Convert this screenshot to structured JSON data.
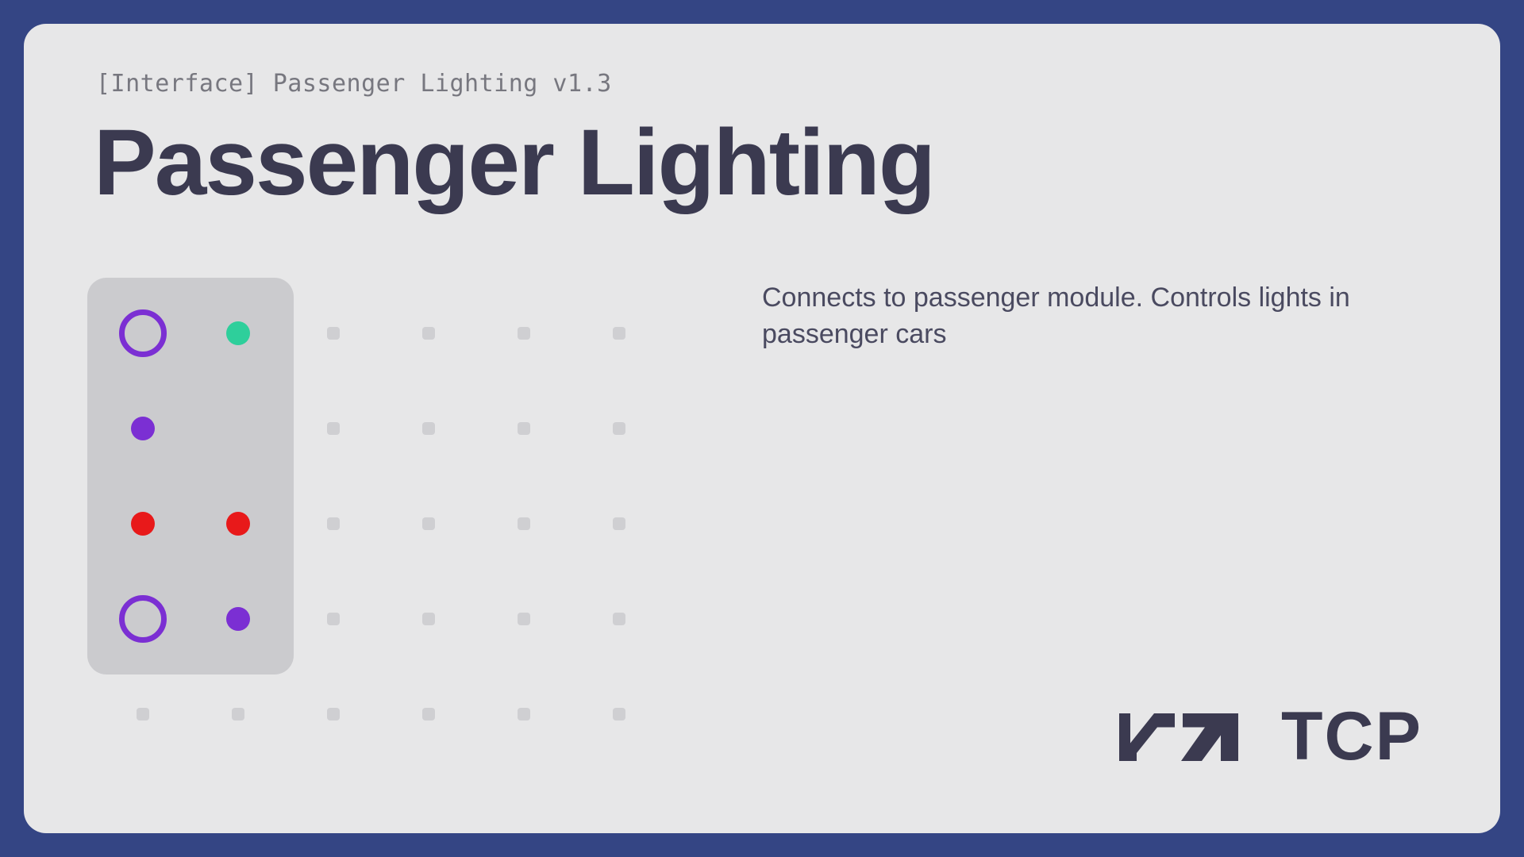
{
  "header": {
    "subtitle": "[Interface] Passenger Lighting v1.3",
    "title": "Passenger Lighting"
  },
  "description": "Connects to passenger module. Controls lights in passenger cars",
  "colors": {
    "background": "#344584",
    "card": "#e7e7e8",
    "panel": "#cbcbce",
    "text_dark": "#3b3a50",
    "purple": "#7b2fd3",
    "green": "#2ecf9b",
    "red": "#e8191a",
    "empty_pin": "#cfcfd2"
  },
  "connector": {
    "columns": 6,
    "rows": 5,
    "pins": [
      {
        "row": 0,
        "col": 0,
        "type": "ring",
        "color": "purple"
      },
      {
        "row": 0,
        "col": 1,
        "type": "dot",
        "color": "green"
      },
      {
        "row": 1,
        "col": 0,
        "type": "dot",
        "color": "purple"
      },
      {
        "row": 1,
        "col": 1,
        "type": "none"
      },
      {
        "row": 2,
        "col": 0,
        "type": "dot",
        "color": "red"
      },
      {
        "row": 2,
        "col": 1,
        "type": "dot",
        "color": "red"
      },
      {
        "row": 3,
        "col": 0,
        "type": "ring",
        "color": "purple"
      },
      {
        "row": 3,
        "col": 1,
        "type": "dot",
        "color": "purple"
      }
    ]
  },
  "logo": {
    "icon": "tcp-arrows-logo-icon",
    "text": "TCP"
  }
}
